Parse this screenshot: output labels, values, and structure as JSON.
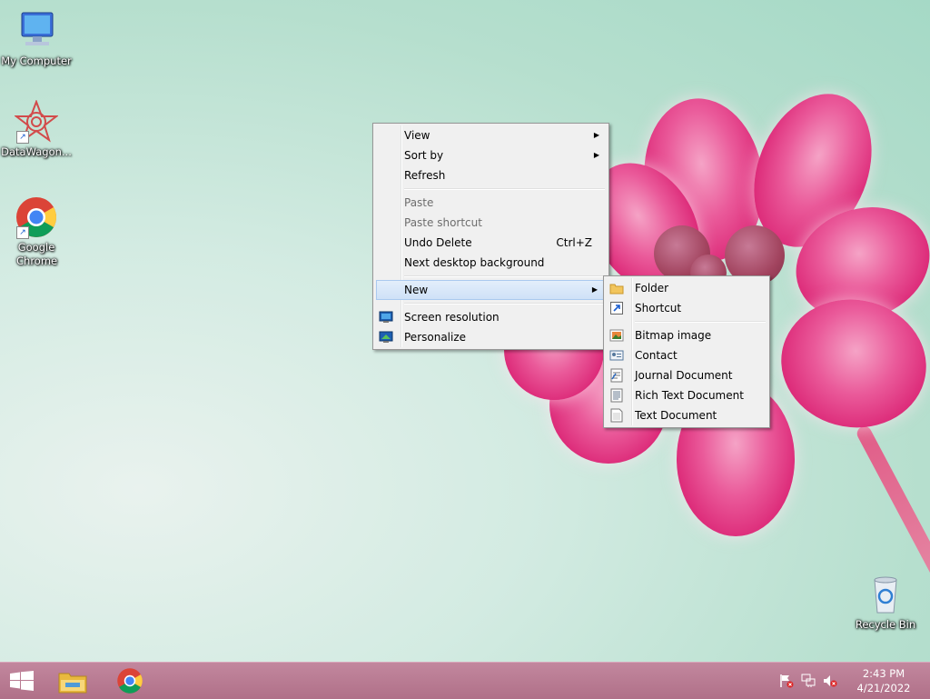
{
  "desktop_icons": [
    {
      "label": "My Computer"
    },
    {
      "label": "DataWagon..."
    },
    {
      "label": "Google Chrome"
    },
    {
      "label": "Recycle Bin"
    }
  ],
  "context_menu": {
    "view": "View",
    "sort_by": "Sort by",
    "refresh": "Refresh",
    "paste": "Paste",
    "paste_shortcut": "Paste shortcut",
    "undo_delete": "Undo Delete",
    "undo_shortcut": "Ctrl+Z",
    "next_background": "Next desktop background",
    "new": "New",
    "screen_resolution": "Screen resolution",
    "personalize": "Personalize"
  },
  "new_submenu": {
    "folder": "Folder",
    "shortcut": "Shortcut",
    "bitmap": "Bitmap image",
    "contact": "Contact",
    "journal": "Journal Document",
    "rich_text": "Rich Text Document",
    "text": "Text Document"
  },
  "taskbar": {
    "time": "2:43 PM",
    "date": "4/21/2022"
  },
  "icons": {
    "start": "windows-logo-icon",
    "explorer": "folder-icon",
    "chrome": "chrome-icon",
    "flag": "action-center-flag-icon",
    "network": "network-icon",
    "volume": "volume-muted-icon"
  },
  "colors": {
    "menu_bg": "#f0f0f0",
    "highlight": "#cfe1f7",
    "taskbar": "#b07088"
  }
}
